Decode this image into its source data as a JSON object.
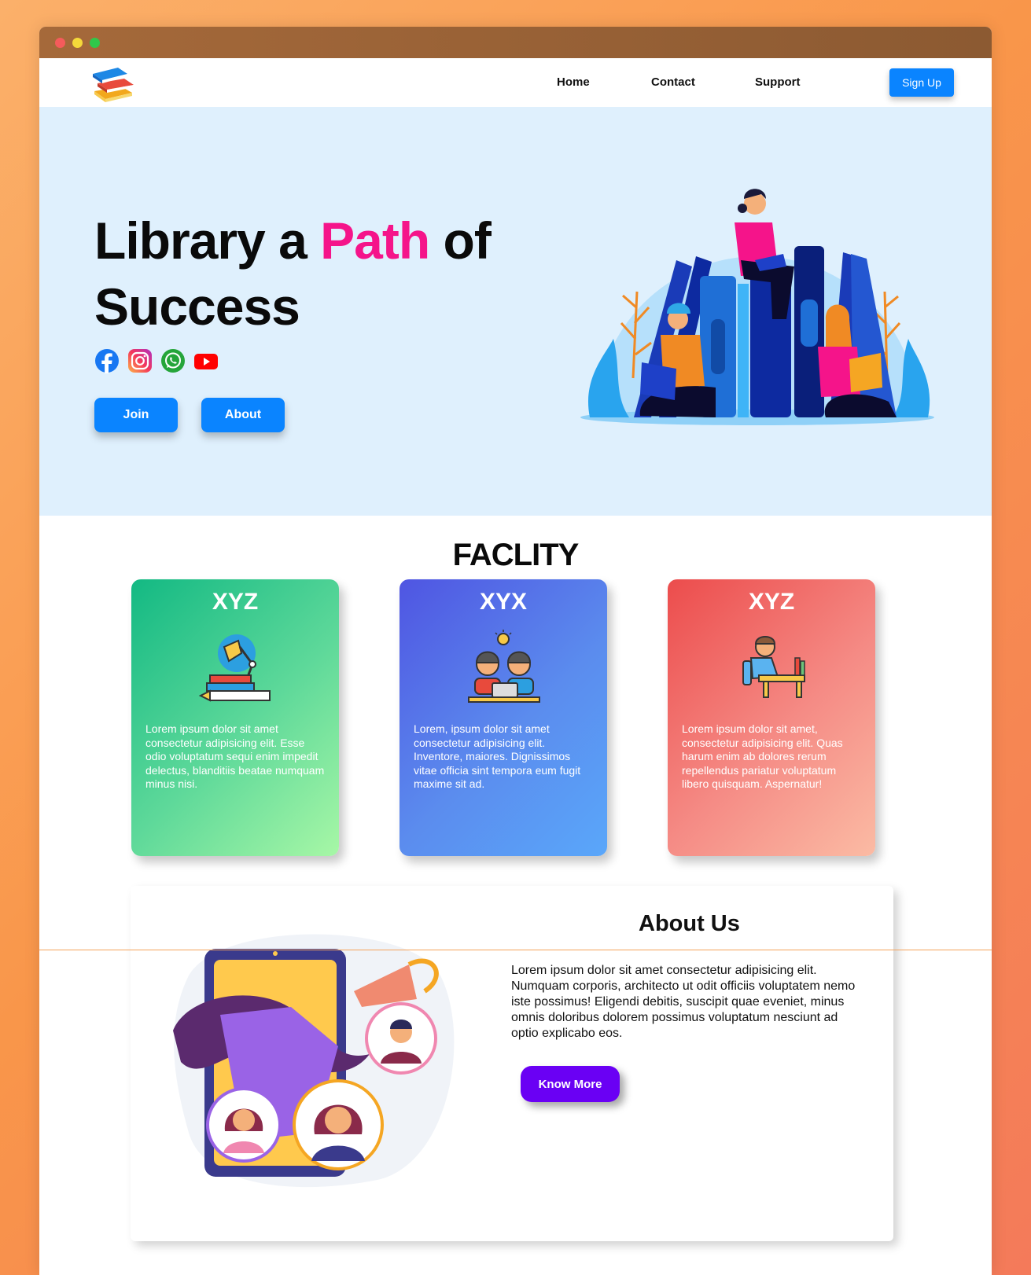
{
  "window": {
    "controls": [
      "close",
      "minimize",
      "maximize"
    ]
  },
  "nav": {
    "logo_icon": "books-stack-logo",
    "links": [
      "Home",
      "Contact",
      "Support"
    ],
    "signup_label": "Sign Up"
  },
  "hero": {
    "title_part1": "Library a ",
    "title_accent": "Path",
    "title_part2": " of",
    "title_line2": "Success",
    "accent_color": "#f5148a",
    "socials": [
      "facebook-icon",
      "instagram-icon",
      "whatsapp-icon",
      "youtube-icon"
    ],
    "join_label": "Join",
    "about_label": "About",
    "illustration": "people-reading-books-illustration"
  },
  "facility": {
    "title": "FACLITY",
    "cards": [
      {
        "title": "XYZ",
        "icon": "desk-lamp-books-icon",
        "text": "Lorem ipsum dolor sit amet consectetur adipisicing elit. Esse odio voluptatum sequi enim impedit delectus, blanditiis beatae numquam minus nisi."
      },
      {
        "title": "XYX",
        "icon": "students-laptop-icon",
        "text": "Lorem, ipsum dolor sit amet consectetur adipisicing elit. Inventore, maiores. Dignissimos vitae officia sint tempora eum fugit maxime sit ad."
      },
      {
        "title": "XYZ",
        "icon": "student-writing-desk-icon",
        "text": "Lorem ipsum dolor sit amet, consectetur adipisicing elit. Quas harum enim ab dolores rerum repellendus pariatur voluptatum libero quisquam. Aspernatur!"
      }
    ]
  },
  "about": {
    "title": "About Us",
    "text": "Lorem ipsum dolor sit amet consectetur adipisicing elit. Numquam corporis, architecto ut odit officiis voluptatem nemo iste possimus! Eligendi debitis, suscipit quae eveniet, minus omnis doloribus dolorem possimus voluptatum nesciunt ad optio explicabo eos.",
    "button_label": "Know More",
    "button_color": "#6a00f4",
    "illustration": "megaphone-phone-community-illustration"
  },
  "colors": {
    "primary": "#0a84ff",
    "hero_bg": "#dff0fd"
  }
}
